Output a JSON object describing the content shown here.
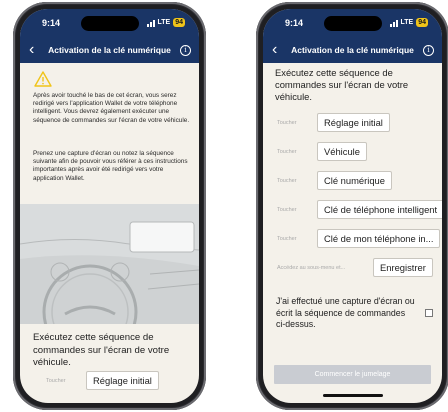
{
  "status": {
    "time": "9:14",
    "network": "LTE",
    "battery": "94"
  },
  "nav": {
    "title": "Activation de la clé numérique",
    "back": "‹",
    "info": "i"
  },
  "left": {
    "para1": "Après avoir touché le bas de cet écran, vous serez redirigé vers l'application Wallet de votre téléphone intelligent. Vous devrez également exécuter une séquence de commandes sur l'écran de votre véhicule.",
    "para2": "Prenez une capture d'écran ou notez la séquence suivante afin de pouvoir vous référer à ces instructions importantes après avoir été redirigé vers votre application Wallet.",
    "instruction": "Exécutez cette séquence de commandes sur l'écran de votre véhicule.",
    "touch_label": "Toucher",
    "first_command": "Réglage initial"
  },
  "right": {
    "instruction": "Exécutez cette séquence de commandes sur l'écran de votre véhicule.",
    "touch_label": "Toucher",
    "commands": [
      "Réglage initial",
      "Véhicule",
      "Clé numérique",
      "Clé de téléphone intelligent",
      "Clé de mon téléphone in..."
    ],
    "submenu_label": "Accédez au sous-menu et...",
    "save_label": "Enregistrer",
    "confirm_text": "J'ai effectué une capture d'écran ou écrit la séquence de commandes ci-dessus.",
    "cta_label": "Commencer le jumelage"
  },
  "colors": {
    "header": "#1a3566",
    "warning": "#f0c419",
    "background": "#f4f1ea",
    "cta_disabled": "#c9ccd2"
  },
  "icons": [
    "chevron-left-icon",
    "info-icon",
    "warning-triangle-icon",
    "signal-icon",
    "battery-icon"
  ]
}
